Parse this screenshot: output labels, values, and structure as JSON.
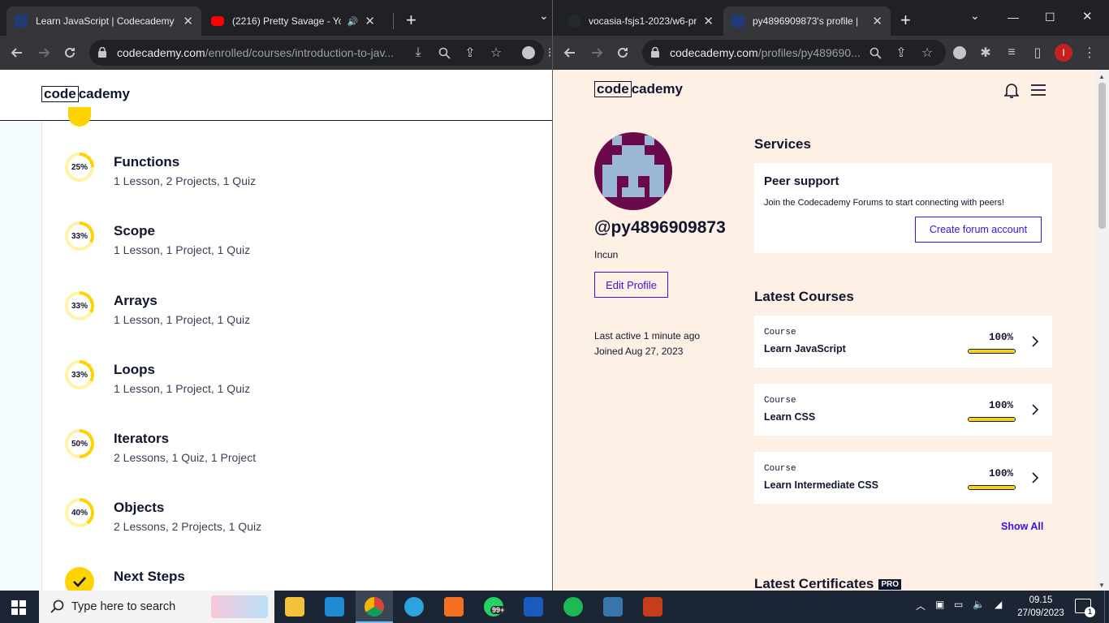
{
  "left_window": {
    "tabs": [
      {
        "title": "Learn JavaScript | Codecademy",
        "active": true
      },
      {
        "title": "(2216) Pretty Savage - YouTu",
        "active": false
      }
    ],
    "url_host": "codecademy.com",
    "url_path": "/enrolled/courses/introduction-to-jav...",
    "logo_boxed": "code",
    "logo_rest": "cademy",
    "modules": [
      {
        "progress": "25%",
        "title": "Functions",
        "subtitle": "1 Lesson, 2 Projects, 1 Quiz"
      },
      {
        "progress": "33%",
        "title": "Scope",
        "subtitle": "1 Lesson, 1 Project, 1 Quiz"
      },
      {
        "progress": "33%",
        "title": "Arrays",
        "subtitle": "1 Lesson, 1 Project, 1 Quiz"
      },
      {
        "progress": "33%",
        "title": "Loops",
        "subtitle": "1 Lesson, 1 Project, 1 Quiz"
      },
      {
        "progress": "50%",
        "title": "Iterators",
        "subtitle": "2 Lessons, 1 Quiz, 1 Project"
      },
      {
        "progress": "40%",
        "title": "Objects",
        "subtitle": "2 Lessons, 2 Projects, 1 Quiz"
      },
      {
        "progress": "100%",
        "title": "Next Steps",
        "subtitle": ""
      }
    ]
  },
  "right_window": {
    "tabs": [
      {
        "title": "vocasia-fsjs1-2023/w6-pr",
        "active": false
      },
      {
        "title": "py4896909873's profile |",
        "active": true
      }
    ],
    "url_host": "codecademy.com",
    "url_path": "/profiles/py489690...",
    "profile_initial": "I",
    "profile": {
      "handle": "@py4896909873",
      "name": "Incun",
      "edit_label": "Edit Profile",
      "last_active": "Last active 1 minute ago",
      "joined": "Joined Aug 27, 2023"
    },
    "services": {
      "heading": "Services",
      "peer_title": "Peer support",
      "peer_desc": "Join the Codecademy Forums to start connecting with peers!",
      "forum_button": "Create forum account"
    },
    "latest_courses": {
      "heading": "Latest Courses",
      "items": [
        {
          "kind": "Course",
          "name": "Learn JavaScript",
          "percent": "100%",
          "progress": 1.0
        },
        {
          "kind": "Course",
          "name": "Learn CSS",
          "percent": "100%",
          "progress": 1.0
        },
        {
          "kind": "Course",
          "name": "Learn Intermediate CSS",
          "percent": "100%",
          "progress": 1.0
        }
      ],
      "show_all": "Show All"
    },
    "certificates": {
      "heading": "Latest Certificates",
      "badge": "PRO"
    }
  },
  "taskbar": {
    "search_placeholder": "Type here to search",
    "time": "09.15",
    "date": "27/09/2023",
    "whatsapp_badge": "99+",
    "notification_count": "1"
  },
  "colors": {
    "accent": "#3a10e5",
    "navy": "#10162f",
    "yellow": "#ffd300",
    "profile_bg": "#fff0e5"
  }
}
